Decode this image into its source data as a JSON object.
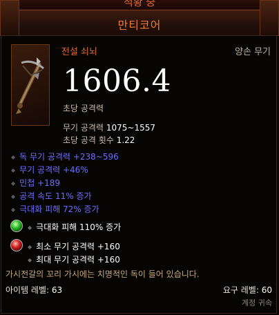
{
  "header": {
    "top_text": "적황 중",
    "title": "만티코어"
  },
  "item": {
    "type": "전설 쇠뇌",
    "slot": "양손 무기",
    "dps": "1606.4",
    "dps_label": "초당 공격력",
    "weapon_damage_label": "무기 공격력",
    "weapon_damage_value": "1075~1557",
    "attack_speed_label": "초당 공격 횟수",
    "attack_speed_value": "1.22"
  },
  "stats": [
    "독 무기 공격력 +238~596",
    "무기 공격력 +46%",
    "민첩 +189",
    "공격 속도 11% 증가",
    "극대화 피해 72% 증가"
  ],
  "sockets": [
    {
      "gem": "green",
      "lines": [
        "극대화 피해 110% 증가"
      ]
    },
    {
      "gem": "red",
      "lines": [
        "최소 무기 공격력 +160",
        "최대 무기 공격력 +160"
      ]
    }
  ],
  "flavor": "가시전갈의 꼬리 가시에는 치명적인 독이 들어 있습니다.",
  "footer": {
    "item_level_label": "아이템 레벨:",
    "item_level": "63",
    "required_level_label": "요구 레벨:",
    "required_level": "60",
    "bind": "계정 귀속"
  },
  "colors": {
    "legendary": "#e06a2e",
    "magic_stat": "#6e6eff",
    "flavor": "#c8a878",
    "gem_green": "#2fbf2a",
    "gem_red": "#d42020"
  },
  "icons": [
    "crossbow-icon",
    "emerald-gem-icon",
    "ruby-gem-icon"
  ]
}
